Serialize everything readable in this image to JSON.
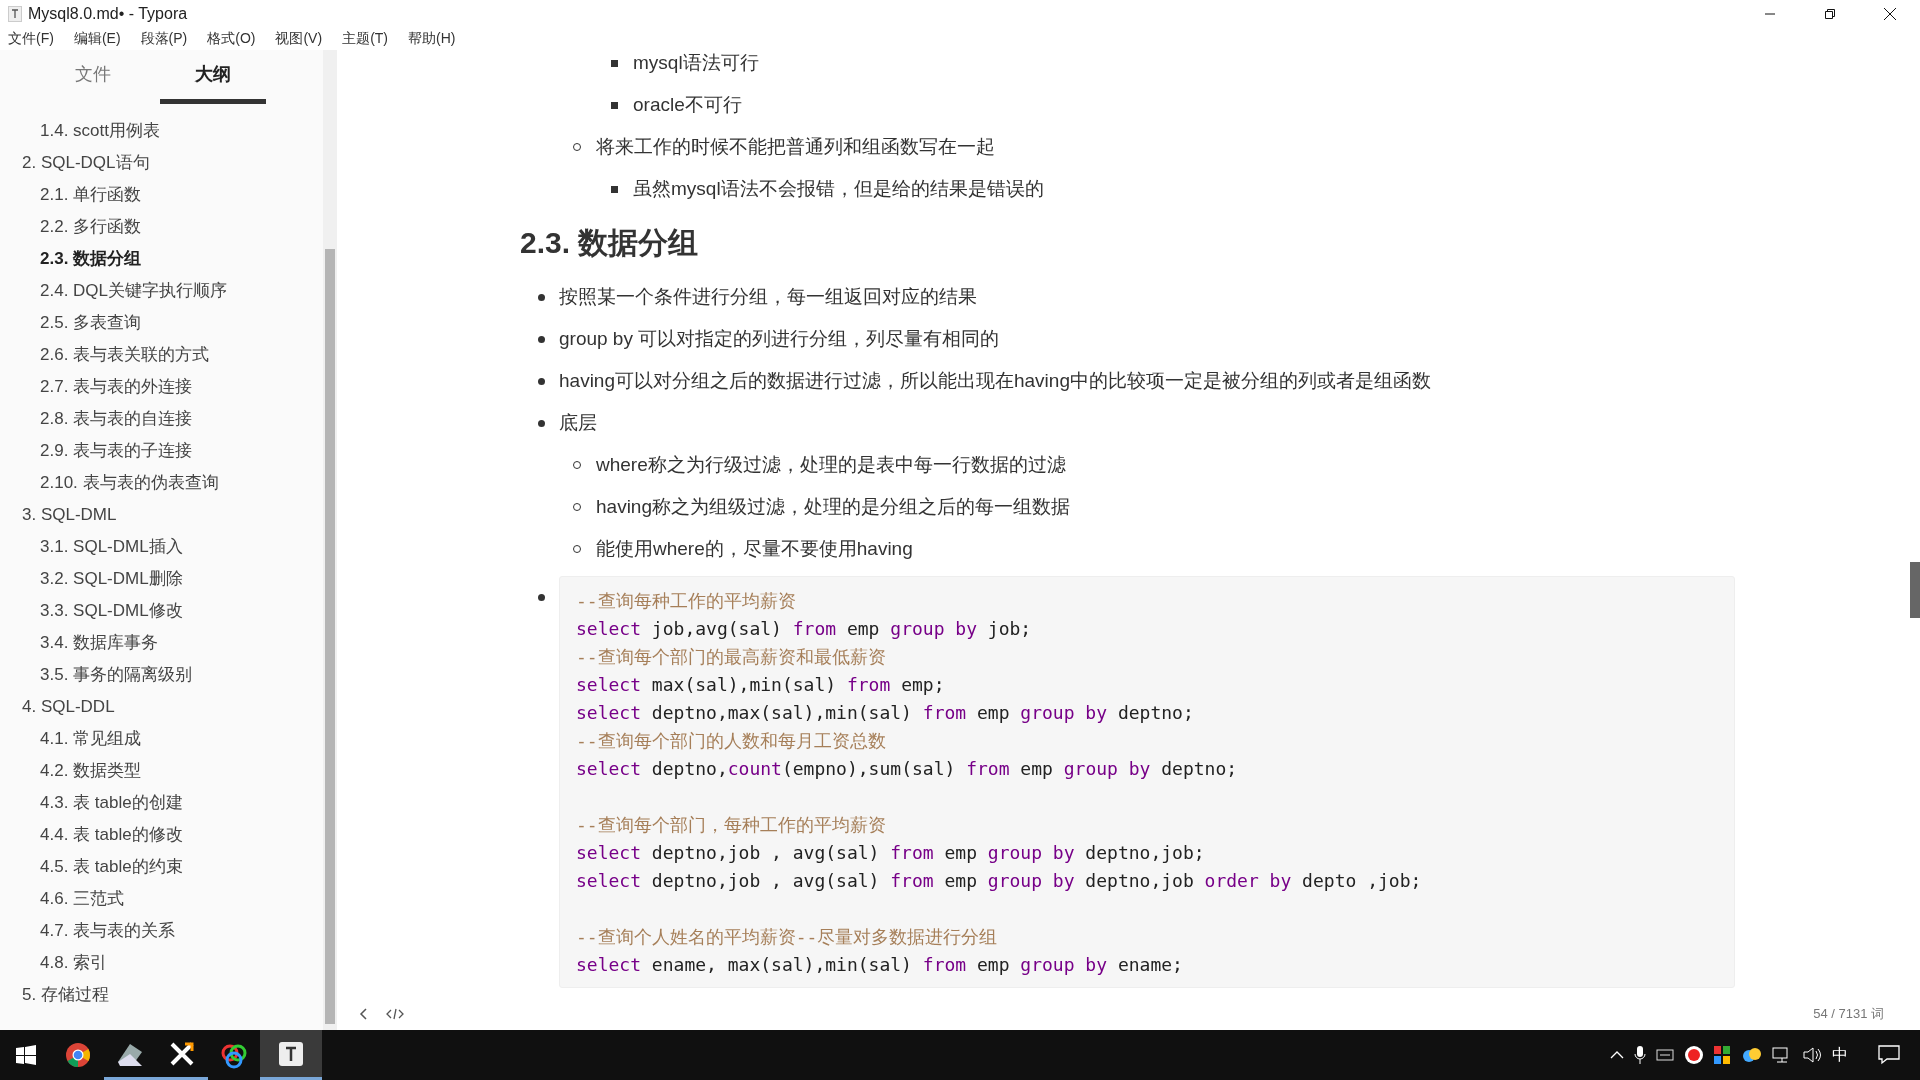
{
  "window": {
    "title": "Mysql8.0.md• - Typora"
  },
  "menu": [
    "文件(F)",
    "编辑(E)",
    "段落(P)",
    "格式(O)",
    "视图(V)",
    "主题(T)",
    "帮助(H)"
  ],
  "sidebar": {
    "tabs": [
      {
        "label": "文件",
        "selected": false
      },
      {
        "label": "大纲",
        "selected": true
      }
    ],
    "outline": [
      {
        "children": [
          {
            "label": "1.4. scott用例表",
            "selected": false
          }
        ]
      },
      {
        "label": "2. SQL-DQL语句",
        "selected": false,
        "children": [
          {
            "label": "2.1. 单行函数",
            "selected": false
          },
          {
            "label": "2.2. 多行函数",
            "selected": false
          },
          {
            "label": "2.3. 数据分组",
            "selected": true
          },
          {
            "label": "2.4. DQL关键字执行顺序",
            "selected": false
          },
          {
            "label": "2.5. 多表查询",
            "selected": false
          },
          {
            "label": "2.6. 表与表关联的方式",
            "selected": false
          },
          {
            "label": "2.7. 表与表的外连接",
            "selected": false
          },
          {
            "label": "2.8. 表与表的自连接",
            "selected": false
          },
          {
            "label": "2.9. 表与表的子连接",
            "selected": false
          },
          {
            "label": "2.10. 表与表的伪表查询",
            "selected": false
          }
        ]
      },
      {
        "label": "3. SQL-DML",
        "selected": false,
        "children": [
          {
            "label": "3.1. SQL-DML插入",
            "selected": false
          },
          {
            "label": "3.2. SQL-DML删除",
            "selected": false
          },
          {
            "label": "3.3. SQL-DML修改",
            "selected": false
          },
          {
            "label": "3.4. 数据库事务",
            "selected": false
          },
          {
            "label": "3.5. 事务的隔离级别",
            "selected": false
          }
        ]
      },
      {
        "label": "4. SQL-DDL",
        "selected": false,
        "children": [
          {
            "label": "4.1. 常见组成",
            "selected": false
          },
          {
            "label": "4.2. 数据类型",
            "selected": false
          },
          {
            "label": "4.3. 表 table的创建",
            "selected": false
          },
          {
            "label": "4.4. 表 table的修改",
            "selected": false
          },
          {
            "label": "4.5. 表 table的约束",
            "selected": false
          },
          {
            "label": "4.6. 三范式",
            "selected": false
          },
          {
            "label": "4.7. 表与表的关系",
            "selected": false
          },
          {
            "label": "4.8. 索引",
            "selected": false
          }
        ]
      },
      {
        "label": "5. 存储过程",
        "selected": false
      }
    ]
  },
  "document": {
    "intro_list": [
      {
        "children": [
          {
            "children": [
              {
                "text": "mysql语法可行"
              },
              {
                "text": "oracle不可行"
              }
            ]
          },
          {
            "text": "将来工作的时候不能把普通列和组函数写在一起",
            "children": [
              {
                "text": "虽然mysql语法不会报错，但是给的结果是错误的"
              }
            ]
          }
        ]
      }
    ],
    "heading": "2.3. 数据分组",
    "list": [
      {
        "kind": "text",
        "text": "按照某一个条件进行分组，每一组返回对应的结果"
      },
      {
        "kind": "text",
        "text": "group by 可以对指定的列进行分组，列尽量有相同的"
      },
      {
        "kind": "text",
        "text": "having可以对分组之后的数据进行过滤，所以能出现在having中的比较项一定是被分组的列或者是组函数"
      },
      {
        "kind": "text",
        "text": "底层",
        "children": [
          {
            "text": "where称之为行级过滤，处理的是表中每一行数据的过滤"
          },
          {
            "text": "having称之为组级过滤，处理的是分组之后的每一组数据"
          },
          {
            "text": "能使用where的，尽量不要使用having"
          }
        ]
      },
      {
        "kind": "code",
        "code_groups": [
          [
            [
              {
                "kind": "comment",
                "text": "--查询每种工作的平均薪资"
              }
            ],
            [
              {
                "kind": "keyword",
                "text": "select"
              },
              {
                "kind": "plain",
                "text": " job,avg(sal) "
              },
              {
                "kind": "keyword",
                "text": "from"
              },
              {
                "kind": "plain",
                "text": " emp "
              },
              {
                "kind": "keyword",
                "text": "group by"
              },
              {
                "kind": "plain",
                "text": " job;"
              }
            ],
            [
              {
                "kind": "comment",
                "text": "--查询每个部门的最高薪资和最低薪资"
              }
            ],
            [
              {
                "kind": "keyword",
                "text": "select"
              },
              {
                "kind": "plain",
                "text": " max(sal),min(sal) "
              },
              {
                "kind": "keyword",
                "text": "from"
              },
              {
                "kind": "plain",
                "text": " emp;"
              }
            ],
            [
              {
                "kind": "keyword",
                "text": "select"
              },
              {
                "kind": "plain",
                "text": " deptno,max(sal),min(sal) "
              },
              {
                "kind": "keyword",
                "text": "from"
              },
              {
                "kind": "plain",
                "text": " emp "
              },
              {
                "kind": "keyword",
                "text": "group by"
              },
              {
                "kind": "plain",
                "text": " deptno;"
              }
            ],
            [
              {
                "kind": "comment",
                "text": "--查询每个部门的人数和每月工资总数"
              }
            ],
            [
              {
                "kind": "keyword",
                "text": "select"
              },
              {
                "kind": "plain",
                "text": " deptno,"
              },
              {
                "kind": "keyword",
                "text": "count"
              },
              {
                "kind": "plain",
                "text": "(empno),sum(sal) "
              },
              {
                "kind": "keyword",
                "text": "from"
              },
              {
                "kind": "plain",
                "text": " emp "
              },
              {
                "kind": "keyword",
                "text": "group by"
              },
              {
                "kind": "plain",
                "text": " deptno;"
              }
            ]
          ],
          [
            [
              {
                "kind": "comment",
                "text": "--查询每个部门，每种工作的平均薪资"
              }
            ],
            [
              {
                "kind": "keyword",
                "text": "select"
              },
              {
                "kind": "plain",
                "text": " deptno,job , avg(sal) "
              },
              {
                "kind": "keyword",
                "text": "from"
              },
              {
                "kind": "plain",
                "text": " emp "
              },
              {
                "kind": "keyword",
                "text": "group by"
              },
              {
                "kind": "plain",
                "text": " deptno,job;"
              }
            ],
            [
              {
                "kind": "keyword",
                "text": "select"
              },
              {
                "kind": "plain",
                "text": " deptno,job , avg(sal) "
              },
              {
                "kind": "keyword",
                "text": "from"
              },
              {
                "kind": "plain",
                "text": " emp "
              },
              {
                "kind": "keyword",
                "text": "group by"
              },
              {
                "kind": "plain",
                "text": " deptno,job "
              },
              {
                "kind": "keyword",
                "text": "order by"
              },
              {
                "kind": "plain",
                "text": " depto ,job;"
              }
            ]
          ],
          [
            [
              {
                "kind": "comment",
                "text": "--查询个人姓名的平均薪资--尽量对多数据进行分组"
              }
            ],
            [
              {
                "kind": "keyword",
                "text": "select"
              },
              {
                "kind": "plain",
                "text": " ename, max(sal),min(sal) "
              },
              {
                "kind": "keyword",
                "text": "from"
              },
              {
                "kind": "plain",
                "text": " emp "
              },
              {
                "kind": "keyword",
                "text": "group by"
              },
              {
                "kind": "plain",
                "text": " ename;"
              }
            ]
          ]
        ]
      }
    ]
  },
  "status_bar": {
    "word_count": "54 / 7131 词"
  },
  "taskbar": {
    "ime": "中"
  }
}
